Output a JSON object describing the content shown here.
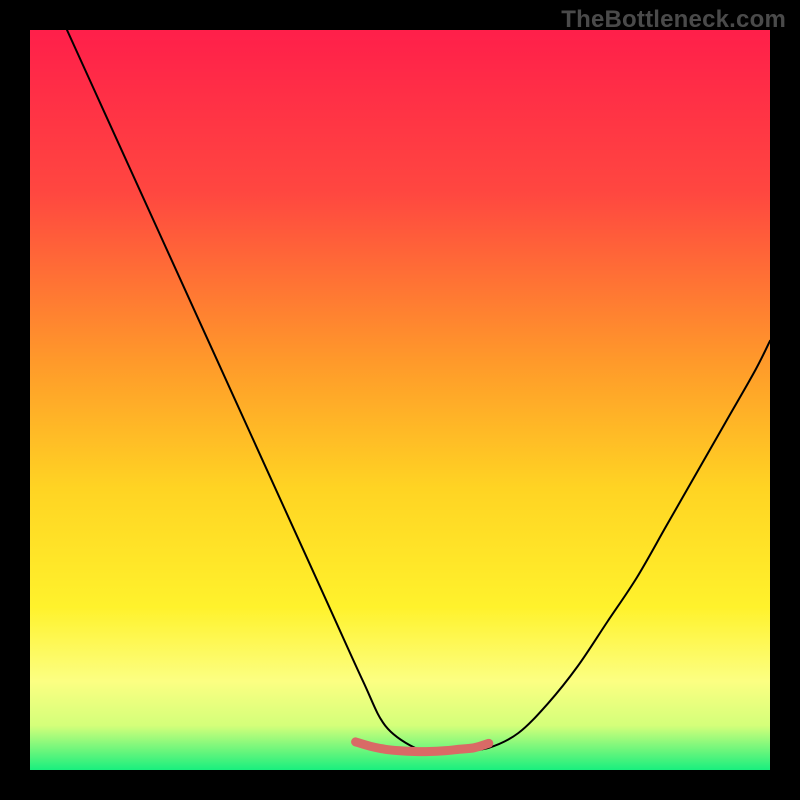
{
  "watermark": "TheBottleneck.com",
  "chart_data": {
    "type": "line",
    "title": "",
    "xlabel": "",
    "ylabel": "",
    "xlim": [
      0,
      100
    ],
    "ylim": [
      0,
      100
    ],
    "grid": false,
    "legend": false,
    "background_gradient": {
      "stops": [
        {
          "offset": 0.0,
          "color": "#ff1f4a"
        },
        {
          "offset": 0.22,
          "color": "#ff4740"
        },
        {
          "offset": 0.45,
          "color": "#ff9a2a"
        },
        {
          "offset": 0.62,
          "color": "#ffd423"
        },
        {
          "offset": 0.78,
          "color": "#fff22c"
        },
        {
          "offset": 0.88,
          "color": "#fcff82"
        },
        {
          "offset": 0.94,
          "color": "#d4ff7a"
        },
        {
          "offset": 1.0,
          "color": "#19ef7e"
        }
      ]
    },
    "series": [
      {
        "name": "bottleneck-curve",
        "color": "#000000",
        "width": 2,
        "x": [
          5,
          10,
          15,
          20,
          25,
          30,
          35,
          40,
          45,
          48,
          52,
          55,
          58,
          62,
          66,
          70,
          74,
          78,
          82,
          86,
          90,
          94,
          98,
          100
        ],
        "y": [
          100,
          89,
          78,
          67,
          56,
          45,
          34,
          23,
          12,
          6,
          3,
          2.5,
          2.5,
          3,
          5,
          9,
          14,
          20,
          26,
          33,
          40,
          47,
          54,
          58
        ]
      },
      {
        "name": "optimal-band",
        "color": "#d96a66",
        "width": 9,
        "x": [
          44,
          46,
          48,
          50,
          52,
          54,
          56,
          58,
          60,
          62
        ],
        "y": [
          3.8,
          3.2,
          2.8,
          2.6,
          2.5,
          2.5,
          2.6,
          2.8,
          3.0,
          3.6
        ]
      }
    ]
  }
}
